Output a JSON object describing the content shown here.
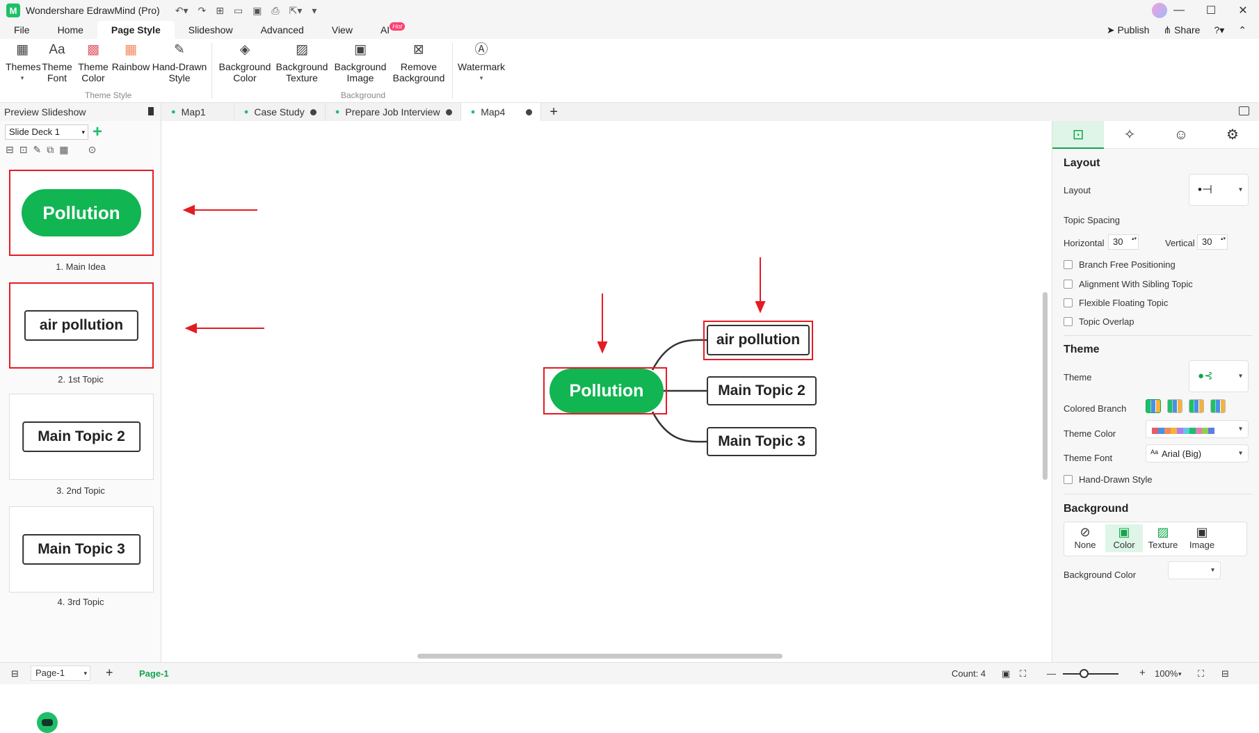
{
  "app": {
    "title": "Wondershare EdrawMind (Pro)"
  },
  "menu": [
    "File",
    "Home",
    "Page Style",
    "Slideshow",
    "Advanced",
    "View",
    "AI"
  ],
  "menu_active": "Page Style",
  "ai_badge": "Hot",
  "header_actions": {
    "publish": "Publish",
    "share": "Share"
  },
  "ribbon": {
    "themes": "Themes",
    "theme_font": "Theme Font",
    "theme_color": "Theme Color",
    "rainbow": "Rainbow",
    "hand_drawn": "Hand-Drawn Style",
    "group_theme": "Theme Style",
    "bg_color": "Background Color",
    "bg_texture": "Background Texture",
    "bg_image": "Background Image",
    "remove_bg": "Remove Background",
    "group_bg": "Background",
    "watermark": "Watermark"
  },
  "left": {
    "header": "Preview Slideshow",
    "deck": "Slide Deck 1",
    "slides": [
      {
        "node": "Pollution",
        "caption": "1. Main Idea"
      },
      {
        "node": "air pollution",
        "caption": "2. 1st Topic"
      },
      {
        "node": "Main Topic 2",
        "caption": "3. 2nd Topic"
      },
      {
        "node": "Main Topic 3",
        "caption": "4. 3rd Topic"
      }
    ]
  },
  "tabs": [
    "Map1",
    "Case Study",
    "Prepare Job Interview",
    "Map4"
  ],
  "map": {
    "central": "Pollution",
    "topics": [
      "air pollution",
      "Main Topic 2",
      "Main Topic 3"
    ]
  },
  "right": {
    "layout_h": "Layout",
    "layout": "Layout",
    "spacing": "Topic Spacing",
    "horizontal": "Horizontal",
    "horizontal_val": "30",
    "vertical": "Vertical",
    "vertical_val": "30",
    "checks": [
      "Branch Free Positioning",
      "Alignment With Sibling Topic",
      "Flexible Floating Topic",
      "Topic Overlap"
    ],
    "theme_h": "Theme",
    "theme": "Theme",
    "colored_branch": "Colored Branch",
    "theme_color": "Theme Color",
    "theme_font": "Theme Font",
    "theme_font_val": "Arial (Big)",
    "hand_drawn": "Hand-Drawn Style",
    "bg_h": "Background",
    "bg_opts": [
      "None",
      "Color",
      "Texture",
      "Image"
    ],
    "bg_color": "Background Color"
  },
  "status": {
    "page_select": "Page-1",
    "page_tab": "Page-1",
    "count": "Count: 4",
    "zoom": "100%"
  },
  "colors": {
    "accent": "#1fbf6a",
    "central": "#11b552",
    "annotation": "#e31b23"
  }
}
